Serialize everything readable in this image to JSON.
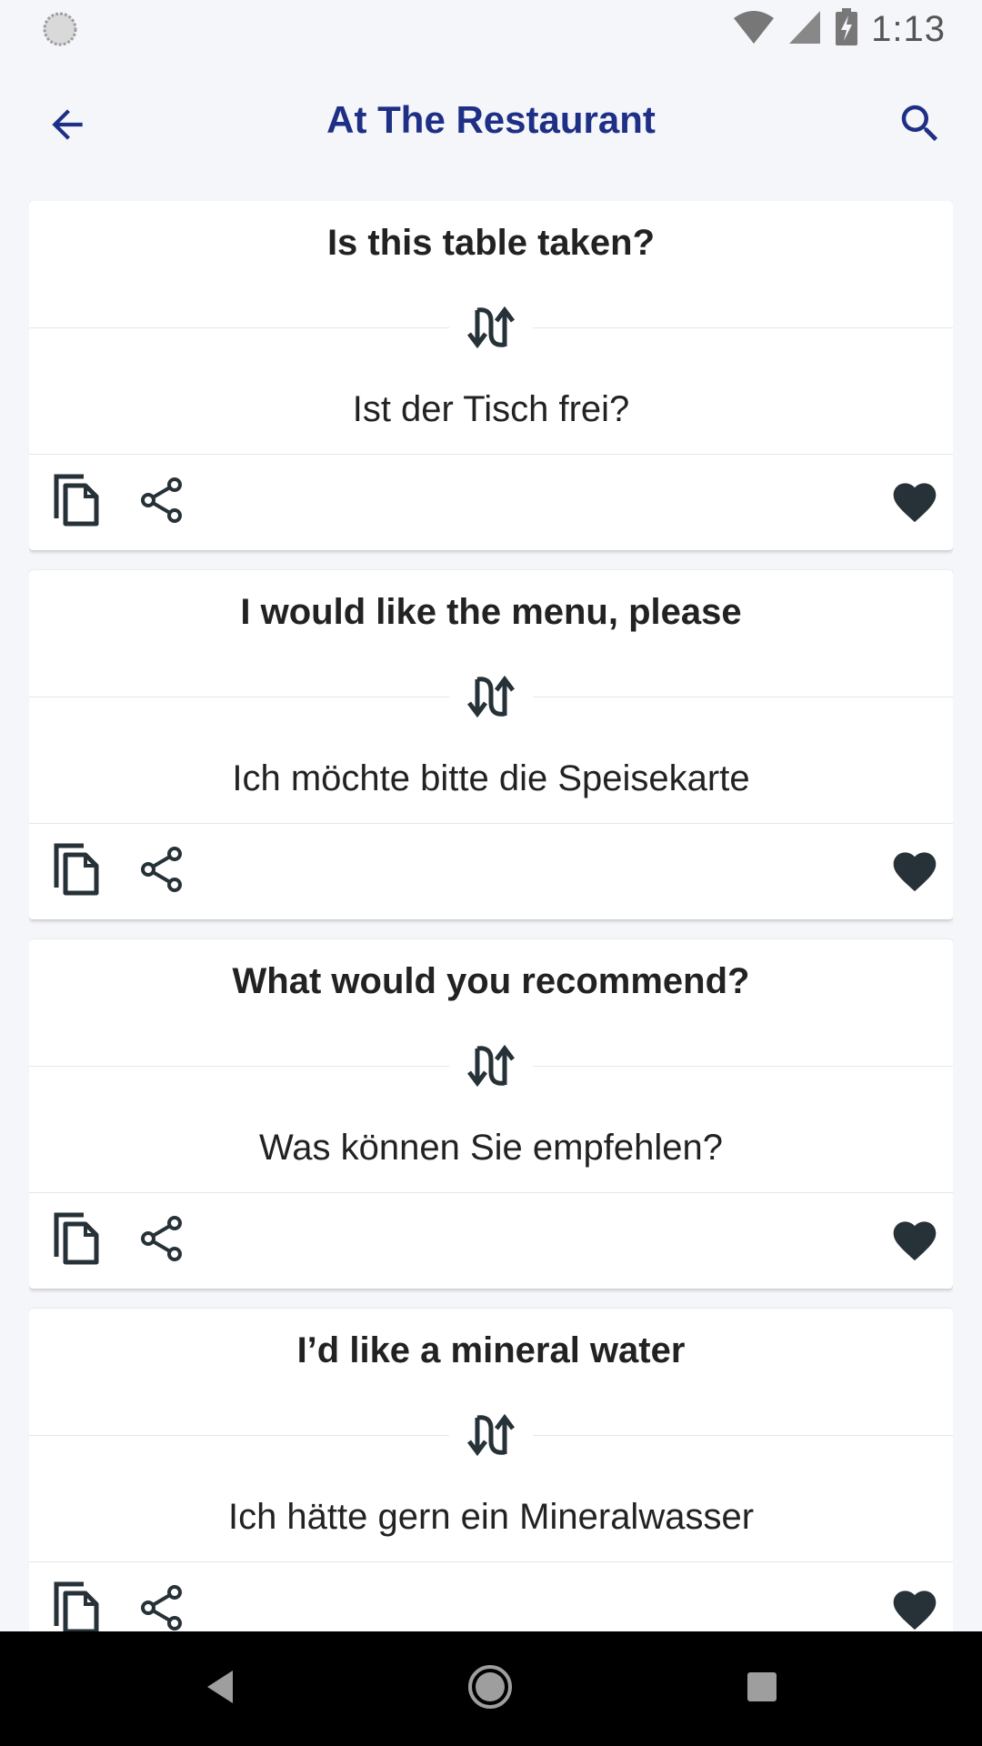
{
  "status_bar": {
    "time": "1:13"
  },
  "app_bar": {
    "title": "At The Restaurant"
  },
  "colors": {
    "title": "#1e2f86",
    "icon": "#263238",
    "background": "#f5f6fa"
  },
  "phrases": [
    {
      "english": "Is this table taken?",
      "german": "Ist der Tisch frei?"
    },
    {
      "english": "I would like the menu, please",
      "german": "Ich möchte bitte die Speisekarte"
    },
    {
      "english": "What would you recommend?",
      "german": "Was können Sie empfehlen?"
    },
    {
      "english": "I’d like a mineral water",
      "german": "Ich hätte gern ein Mineralwasser"
    }
  ],
  "icons": {
    "back": "arrow-left-icon",
    "search": "search-icon",
    "swap": "swap-vertical-icon",
    "copy": "copy-icon",
    "share": "share-icon",
    "favorite": "heart-icon"
  }
}
